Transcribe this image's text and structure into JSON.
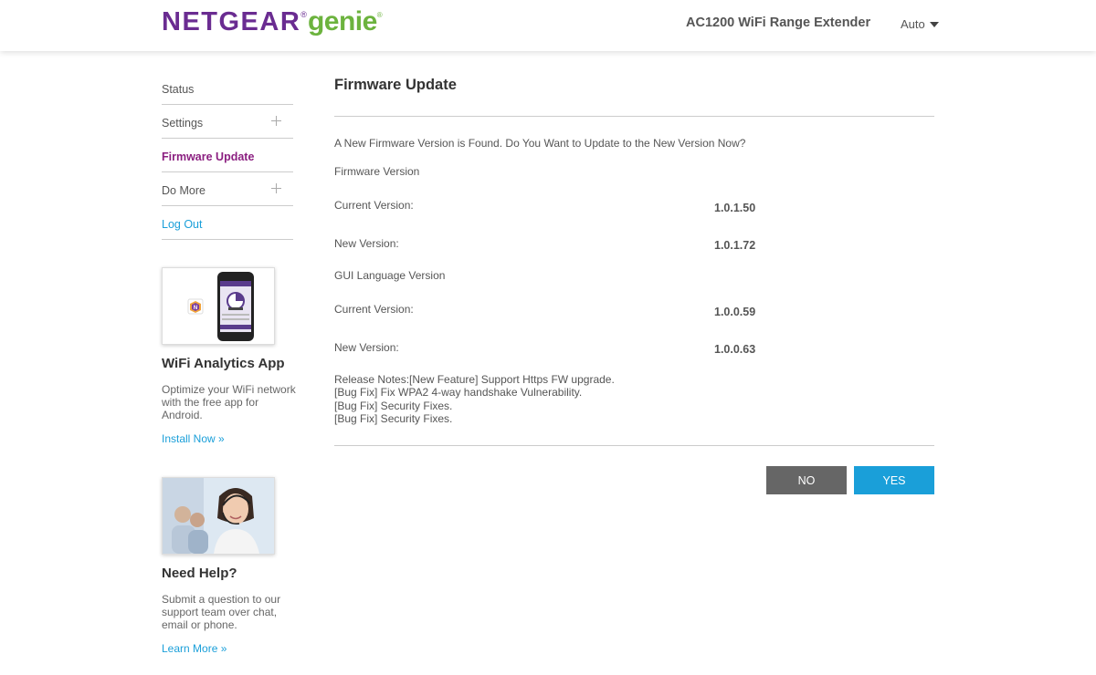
{
  "header": {
    "logo_main": "NETGEAR",
    "logo_sub": "genie",
    "product_name": "AC1200 WiFi Range Extender",
    "language": "Auto"
  },
  "sidebar": {
    "items": [
      {
        "label": "Status"
      },
      {
        "label": "Settings"
      },
      {
        "label": "Firmware Update"
      },
      {
        "label": "Do More"
      },
      {
        "label": "Log Out"
      }
    ]
  },
  "promos": {
    "app": {
      "title": "WiFi Analytics App",
      "text": "Optimize your WiFi network with the free app for Android.",
      "link": "Install Now »"
    },
    "help": {
      "title": "Need Help?",
      "text": "Submit a question to our support team over chat, email or phone.",
      "link": "Learn More »"
    }
  },
  "main": {
    "title": "Firmware Update",
    "prompt": "A New Firmware Version is Found. Do You Want to Update to the New Version Now?",
    "firmware": {
      "heading": "Firmware Version",
      "current_label": "Current Version:",
      "current_value": "1.0.1.50",
      "new_label": "New Version:",
      "new_value": "1.0.1.72"
    },
    "gui": {
      "heading": "GUI Language Version",
      "current_label": "Current Version:",
      "current_value": "1.0.0.59",
      "new_label": "New Version:",
      "new_value": "1.0.0.63"
    },
    "release_notes": [
      "Release Notes:[New Feature] Support Https FW upgrade.",
      "[Bug Fix] Fix WPA2 4-way handshake Vulnerability.",
      "[Bug Fix] Security Fixes.",
      "[Bug Fix] Security Fixes."
    ],
    "buttons": {
      "no": "NO",
      "yes": "YES"
    }
  },
  "colors": {
    "brand_purple": "#6a2c91",
    "brand_green": "#6cb33e",
    "active_nav": "#8b1f80",
    "link_blue": "#1a9fd9",
    "button_gray": "#666666",
    "button_blue": "#1a9fd9"
  },
  "icons": {
    "expand": "plus-icon",
    "dropdown": "caret-down-icon"
  }
}
